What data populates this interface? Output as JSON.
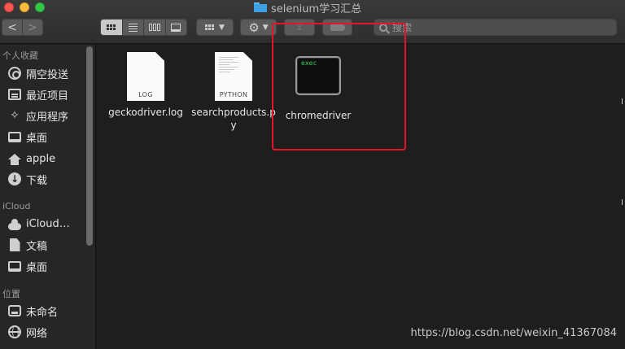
{
  "window": {
    "title": "selenium学习汇总"
  },
  "toolbar": {
    "back_label": "<",
    "forward_label": ">",
    "search_placeholder": "搜索"
  },
  "sidebar": {
    "sections": [
      {
        "label": "个人收藏"
      },
      {
        "label": "iCloud"
      },
      {
        "label": "位置"
      }
    ],
    "favorites": [
      {
        "label": "隔空投送",
        "icon": "airdrop-icon"
      },
      {
        "label": "最近项目",
        "icon": "recent-icon"
      },
      {
        "label": "应用程序",
        "icon": "applications-icon"
      },
      {
        "label": "桌面",
        "icon": "desktop-icon"
      },
      {
        "label": "apple",
        "icon": "home-icon"
      },
      {
        "label": "下载",
        "icon": "download-icon"
      }
    ],
    "icloud": [
      {
        "label": "iCloud…",
        "icon": "cloud-icon"
      },
      {
        "label": "文稿",
        "icon": "document-icon"
      },
      {
        "label": "桌面",
        "icon": "desktop-icon"
      }
    ],
    "locations": [
      {
        "label": "未命名",
        "icon": "disk-icon"
      },
      {
        "label": "网络",
        "icon": "globe-icon"
      }
    ]
  },
  "files": [
    {
      "name": "geckodriver.log",
      "kind": "LOG"
    },
    {
      "name": "searchproducts.py",
      "name_line1": "searchproducts.p",
      "name_line2": "y",
      "kind": "PYTHON"
    },
    {
      "name": "chromedriver",
      "kind": "exec"
    }
  ],
  "colors": {
    "highlight": "#e3152b",
    "exec_text": "#30d158",
    "folder": "#3ea0e4"
  },
  "watermark": "https://blog.csdn.net/weixin_41367084"
}
